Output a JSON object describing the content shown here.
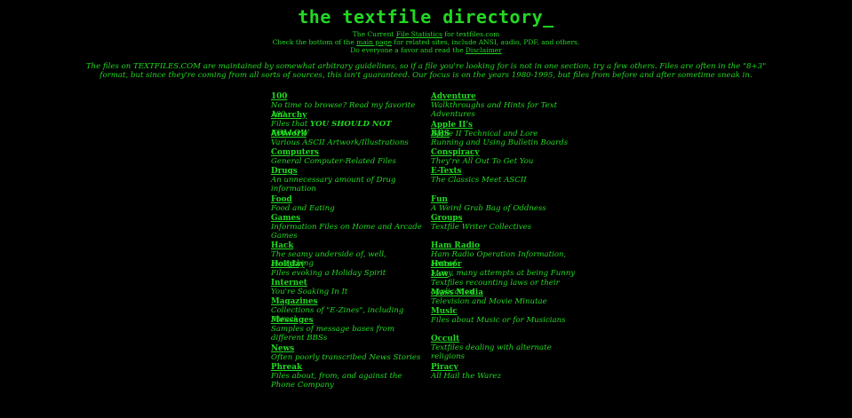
{
  "header": {
    "title": "the textfile directory_"
  },
  "intro": {
    "line1_pre": "The Current ",
    "line1_link": "File Statistics",
    "line1_post": " for textfiles.com",
    "line2_pre": "Check the bottom of the ",
    "line2_link": "main page",
    "line2_post": " for related sites, include ANSI, audio, PDF, and others.",
    "line3_pre": "Do everyone a favor and read the ",
    "line3_link": "Disclaimer"
  },
  "blurb": "The files on TEXTFILES.COM are maintained by somewhat arbitrary guidelines, so if a file you're looking for is not in one section, try a few others. Files are often in the \"8+3\" format, but since they're coming from all sorts of sources, this isn't guaranteed. Our focus is on the years 1980-1995, but files from before and after sometime sneak in.",
  "colors": {
    "background": "#000000",
    "text": "#22d822"
  },
  "left": [
    {
      "name": "100",
      "desc": "No time to browse? Read my favorite 100",
      "row": 1,
      "span": 2
    },
    {
      "name": "Anarchy",
      "desc_pre": "Files that ",
      "desc_bold": "YOU SHOULD NOT FOLLOW",
      "row": 3,
      "span": 2
    },
    {
      "name": "Artwork",
      "desc": "Various ASCII Artwork/Illustrations",
      "row": 5,
      "span": 2
    },
    {
      "name": "Computers",
      "desc": "General Computer-Related Files",
      "row": 7,
      "span": 2
    },
    {
      "name": "Drugs",
      "desc": "An unnecessary amount of Drug information",
      "row": 9,
      "span": 3
    },
    {
      "name": "Food",
      "desc": "Food and Eating",
      "row": 12,
      "span": 2
    },
    {
      "name": "Games",
      "desc": "Information Files on Home and Arcade Games",
      "row": 14,
      "span": 3
    },
    {
      "name": "Hack",
      "desc": "The seamy underside of, well, Everything",
      "row": 17,
      "span": 2
    },
    {
      "name": "Holiday",
      "desc": "Files evoking a Holiday Spirit",
      "row": 19,
      "span": 2
    },
    {
      "name": "Internet",
      "desc": "You're Soaking In It",
      "row": 21,
      "span": 2
    },
    {
      "name": "Magazines",
      "desc": "Collections of \"E-Zines\", including Phrack",
      "row": 23,
      "span": 2
    },
    {
      "name": "Messages",
      "desc": "Samples of message bases from different BBSs",
      "row": 25,
      "span": 3
    },
    {
      "name": "News",
      "desc": "Often poorly transcribed News Stories",
      "row": 28,
      "span": 2
    },
    {
      "name": "Phreak",
      "desc": "Files about, from, and against the Phone Company",
      "row": 30,
      "span": 3
    }
  ],
  "right": [
    {
      "name": "Adventure",
      "desc": "Walkthroughs and Hints for Text Adventures",
      "row": 1,
      "span": 3
    },
    {
      "name": "Apple II's",
      "desc": "Apple II Technical and Lore",
      "row": 4,
      "span": 1
    },
    {
      "name": "BBS",
      "desc": "Running and Using Bulletin Boards",
      "row": 5,
      "span": 2
    },
    {
      "name": "Conspiracy",
      "desc": "They're All Out To Get You",
      "row": 7,
      "span": 2
    },
    {
      "name": "E-Texts",
      "desc": "The Classics Meet ASCII",
      "row": 9,
      "span": 3
    },
    {
      "name": "Fun",
      "desc": "A Weird Grab Bag of Oddness",
      "row": 12,
      "span": 2
    },
    {
      "name": "Groups",
      "desc": "Textfile Writer Collectives",
      "row": 14,
      "span": 3
    },
    {
      "name": "Ham Radio",
      "desc": "Ham Radio Operation Information, sort of",
      "row": 17,
      "span": 2
    },
    {
      "name": "Humor",
      "desc": "Many, many attempts at being Funny",
      "row": 19,
      "span": 1
    },
    {
      "name": "Law",
      "desc": "Textfiles recounting laws or their application",
      "row": 20,
      "span": 2
    },
    {
      "name": "Mass Media",
      "desc": "Television and Movie Minutae",
      "row": 22,
      "span": 2
    },
    {
      "name": "Music",
      "desc": "Files about Music or for Musicians",
      "row": 24,
      "span": 3
    },
    {
      "name": "Occult",
      "desc": "Textfiles dealing with alternate religions",
      "row": 27,
      "span": 3
    },
    {
      "name": "Piracy",
      "desc": "All Hail the Warez",
      "row": 30,
      "span": 2
    }
  ]
}
